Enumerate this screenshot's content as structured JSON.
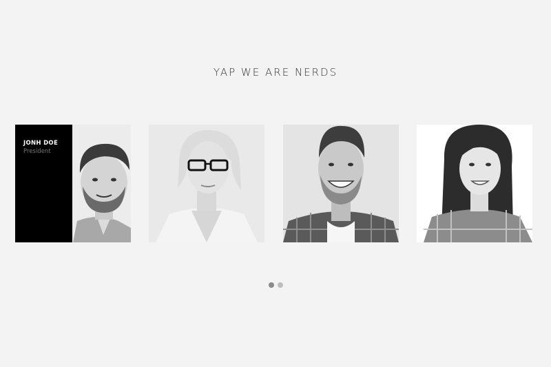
{
  "section": {
    "title": "YAP WE ARE NERDS"
  },
  "team": [
    {
      "name": "JONH DOE",
      "role": "President",
      "photo_icon": "man-beard-portrait"
    },
    {
      "photo_icon": "woman-glasses-portrait"
    },
    {
      "photo_icon": "man-smiling-plaid-portrait"
    },
    {
      "photo_icon": "woman-long-hair-portrait"
    }
  ],
  "carousel": {
    "pages": 2,
    "active_page": 1
  },
  "colors": {
    "background": "#f3f3f3",
    "overlay": "#000000",
    "dot_active": "#8a8a8a",
    "dot_inactive": "#bdbdbd"
  }
}
